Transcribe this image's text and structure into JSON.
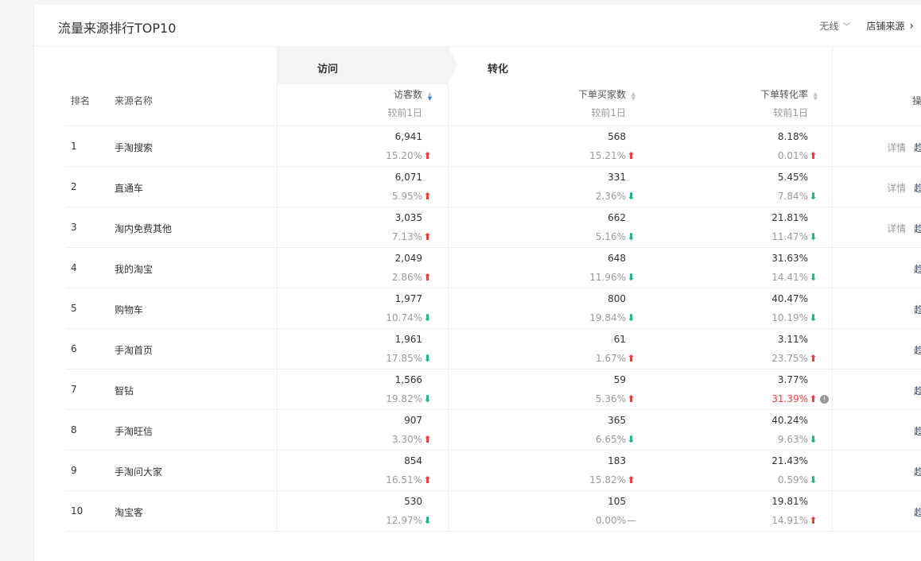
{
  "card": {
    "title": "流量来源排行TOP10",
    "device_label": "无线",
    "shop_source_label": "店铺来源"
  },
  "groups": {
    "visit": "访问",
    "conversion": "转化"
  },
  "columns": {
    "rank": "排名",
    "source_name": "来源名称",
    "visitors": "访客数",
    "buyers": "下单买家数",
    "rate": "下单转化率",
    "compare": "较前1日",
    "action": "操作"
  },
  "actions": {
    "detail": "详情",
    "trend": "趋势"
  },
  "rows": [
    {
      "rank": "1",
      "name": "手淘搜索",
      "visitors": "6,941",
      "visitors_chg": "15.20%",
      "visitors_dir": "up",
      "buyers": "568",
      "buyers_chg": "15.21%",
      "buyers_dir": "up",
      "rate": "8.18%",
      "rate_chg": "0.01%",
      "rate_dir": "up",
      "has_detail": true
    },
    {
      "rank": "2",
      "name": "直通车",
      "visitors": "6,071",
      "visitors_chg": "5.95%",
      "visitors_dir": "up",
      "buyers": "331",
      "buyers_chg": "2.36%",
      "buyers_dir": "down",
      "rate": "5.45%",
      "rate_chg": "7.84%",
      "rate_dir": "down",
      "has_detail": true
    },
    {
      "rank": "3",
      "name": "淘内免费其他",
      "visitors": "3,035",
      "visitors_chg": "7.13%",
      "visitors_dir": "up",
      "buyers": "662",
      "buyers_chg": "5.16%",
      "buyers_dir": "down",
      "rate": "21.81%",
      "rate_chg": "11.47%",
      "rate_dir": "down",
      "has_detail": true
    },
    {
      "rank": "4",
      "name": "我的淘宝",
      "visitors": "2,049",
      "visitors_chg": "2.86%",
      "visitors_dir": "up",
      "buyers": "648",
      "buyers_chg": "11.96%",
      "buyers_dir": "down",
      "rate": "31.63%",
      "rate_chg": "14.41%",
      "rate_dir": "down",
      "has_detail": false
    },
    {
      "rank": "5",
      "name": "购物车",
      "visitors": "1,977",
      "visitors_chg": "10.74%",
      "visitors_dir": "down",
      "buyers": "800",
      "buyers_chg": "19.84%",
      "buyers_dir": "down",
      "rate": "40.47%",
      "rate_chg": "10.19%",
      "rate_dir": "down",
      "has_detail": false
    },
    {
      "rank": "6",
      "name": "手淘首页",
      "visitors": "1,961",
      "visitors_chg": "17.85%",
      "visitors_dir": "down",
      "buyers": "61",
      "buyers_chg": "1.67%",
      "buyers_dir": "up",
      "rate": "3.11%",
      "rate_chg": "23.75%",
      "rate_dir": "up",
      "has_detail": false
    },
    {
      "rank": "7",
      "name": "智钻",
      "visitors": "1,566",
      "visitors_chg": "19.82%",
      "visitors_dir": "down",
      "buyers": "59",
      "buyers_chg": "5.36%",
      "buyers_dir": "up",
      "rate": "3.77%",
      "rate_chg": "31.39%",
      "rate_dir": "up",
      "rate_highlight": true,
      "has_detail": false
    },
    {
      "rank": "8",
      "name": "手淘旺信",
      "visitors": "907",
      "visitors_chg": "3.30%",
      "visitors_dir": "up",
      "buyers": "365",
      "buyers_chg": "6.65%",
      "buyers_dir": "down",
      "rate": "40.24%",
      "rate_chg": "9.63%",
      "rate_dir": "down",
      "has_detail": false
    },
    {
      "rank": "9",
      "name": "手淘问大家",
      "visitors": "854",
      "visitors_chg": "16.51%",
      "visitors_dir": "up",
      "buyers": "183",
      "buyers_chg": "15.82%",
      "buyers_dir": "up",
      "rate": "21.43%",
      "rate_chg": "0.59%",
      "rate_dir": "down",
      "has_detail": false
    },
    {
      "rank": "10",
      "name": "淘宝客",
      "visitors": "530",
      "visitors_chg": "12.97%",
      "visitors_dir": "down",
      "buyers": "105",
      "buyers_chg": "0.00%",
      "buyers_dir": "flat",
      "rate": "19.81%",
      "rate_chg": "14.91%",
      "rate_dir": "up",
      "has_detail": false
    }
  ],
  "colors": {
    "up": "#e8413b",
    "down": "#1fb58f",
    "link": "#3c4a6b",
    "sort_active": "#2e7ef2"
  }
}
